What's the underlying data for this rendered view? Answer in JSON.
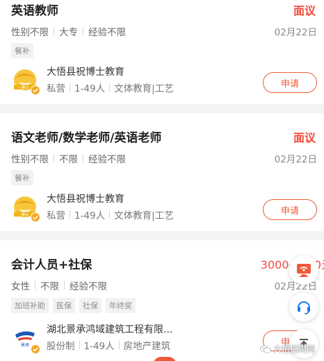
{
  "jobs": [
    {
      "title": "英语教师",
      "salary": "面议",
      "requirements": [
        "性别不限",
        "大专",
        "经验不限"
      ],
      "date": "02月22日",
      "tags": [
        "餐补"
      ],
      "company": "大悟县祝博士教育",
      "company_info": [
        "私营",
        "1-49人",
        "文体教育|工艺"
      ],
      "apply_label": "申请",
      "logo_text": "博士"
    },
    {
      "title": "语文老师/数学老师/英语老师",
      "salary": "面议",
      "requirements": [
        "性别不限",
        "不限",
        "经验不限"
      ],
      "date": "02月22日",
      "tags": [
        "餐补"
      ],
      "company": "大悟县祝博士教育",
      "company_info": [
        "私营",
        "1-49人",
        "文体教育|工艺"
      ],
      "apply_label": "申请",
      "logo_text": "博士"
    },
    {
      "title": "会计人员+社保",
      "salary": "3000-4000元",
      "requirements": [
        "女性",
        "不限",
        "经验不限"
      ],
      "date": "02月22日",
      "tags": [
        "加班补助",
        "医保",
        "社保",
        "年终奖"
      ],
      "company": "湖北景承鸿域建筑工程有限...",
      "company_info": [
        "股份制",
        "1-49人",
        "房地产建筑"
      ],
      "apply_label": "申请",
      "logo_text": "景承"
    }
  ],
  "watermark": "大悟招聘网",
  "colors": {
    "accent": "#ef4b3c",
    "apply_border": "#ef5a3a",
    "verified_badge": "#f5a623"
  },
  "icons": {
    "fab_top": "monitor-icon",
    "fab_middle": "headset-icon",
    "fab_bottom": "top-arrow-icon",
    "verified": "verified-check-icon"
  }
}
